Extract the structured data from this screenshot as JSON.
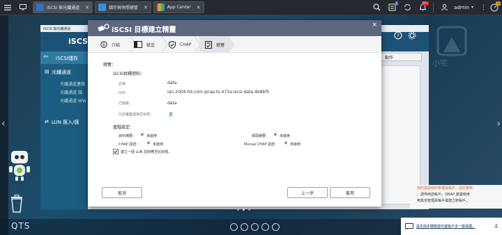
{
  "taskbar": {
    "tabs": [
      {
        "label": "iSCSI 與光纖通道"
      },
      {
        "label": "儲存與快照總管"
      },
      {
        "label": "App Center"
      }
    ],
    "notification_badge_1": "1",
    "notification_badge_2": "10+",
    "user_name": "admin",
    "user_dropdown": "▾",
    "more_icon": "⋮",
    "dashboard_badge": "32",
    "colors": {
      "badge_blue": "#2d7fd3",
      "badge_red": "#d9262c",
      "badge_yellow": "#e4a81a"
    }
  },
  "bg_window": {
    "titlebar": "iSCSI 與光纖通道",
    "header_title": "iSCSI",
    "sidebar": {
      "storage_label": "iSCSI儲存",
      "fc_label": "光纖通道",
      "fc_subitems": [
        "光纖通道連接",
        "光纖通道 儲",
        "光纖通道 WW"
      ],
      "lun_label": "LUN 匯入/匯"
    },
    "action_label": "動作"
  },
  "wizard": {
    "title": "iSCSI 目標建立精靈",
    "close": "×",
    "steps": [
      {
        "label": "介紹"
      },
      {
        "label": "設定"
      },
      {
        "label": "CHAP"
      },
      {
        "label": "總覽"
      }
    ],
    "summary_heading": "總覽：",
    "target_info_heading": "iSCSI目標資料：",
    "fields": [
      {
        "label": "名稱",
        "value": "data"
      },
      {
        "label": "IQN：",
        "value": "iqn.2004-04.com.qnap:ts-473a:iscsi.data.4b8bf5"
      },
      {
        "label": "已啟載",
        "value": "data"
      },
      {
        "label": "允許叢集連接至目標：",
        "value": "是"
      }
    ],
    "advanced_heading": "進階設定：",
    "advanced_left": [
      {
        "label": "資料摘要：",
        "value": "未啟用"
      },
      {
        "label": "CHAP 認證：",
        "value": "未啟用"
      }
    ],
    "advanced_right": [
      {
        "label": "標頭摘要：",
        "value": "未啟用"
      },
      {
        "label": "Mutual CHAP 認證：",
        "value": "未啟用"
      }
    ],
    "checkbox_label": "建立一個 LUN 並對應至此目標。",
    "buttons": {
      "cancel": "取消",
      "back": "上一步",
      "apply": "套用"
    }
  },
  "desktop": {
    "logo": "QTS",
    "watermark": "小宅",
    "notification_text": [
      "用的是開放的管理員帳戶，並於使用",
      "。請停用該帳戶。QNAP 建議使用",
      "用其他管理員帳戶或建立新帳戶。"
    ],
    "notification_link": "設定兩步驟驗證可讓帳戶多一層保護。",
    "notification_close": "×"
  }
}
